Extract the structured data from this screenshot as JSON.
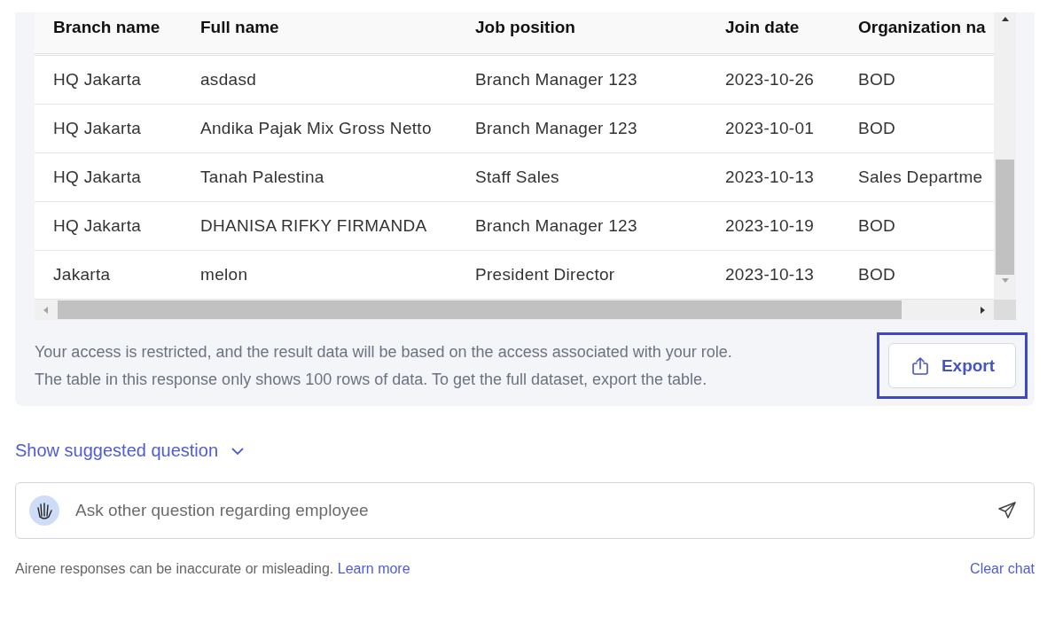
{
  "table": {
    "columns": [
      "Branch name",
      "Full name",
      "Job position",
      "Join date",
      "Organization na"
    ],
    "rows": [
      [
        "HQ Jakarta",
        "asdasd",
        "Branch Manager 123",
        "2023-10-26",
        "BOD"
      ],
      [
        "HQ Jakarta",
        "Andika Pajak Mix Gross Netto",
        "Branch Manager 123",
        "2023-10-01",
        "BOD"
      ],
      [
        "HQ Jakarta",
        "Tanah Palestina",
        "Staff Sales",
        "2023-10-13",
        "Sales Departme"
      ],
      [
        "HQ Jakarta",
        "DHANISA RIFKY FIRMANDA",
        "Branch Manager 123",
        "2023-10-19",
        "BOD"
      ],
      [
        "Jakarta",
        "melon",
        "President Director",
        "2023-10-13",
        "BOD"
      ]
    ]
  },
  "notice": [
    "Your access is restricted, and the result data will be based on the access associated with your role.",
    "The table in this response only shows 100 rows of data. To get the full dataset, export the table."
  ],
  "export_button": {
    "label": "Export",
    "highlighted": true
  },
  "suggested_toggle": "Show suggested question",
  "ask_field": {
    "placeholder": "Ask other question regarding employee"
  },
  "footer": {
    "disclaimer": "Airene responses can be inaccurate or misleading.",
    "link": "Learn more",
    "clear": "Clear chat"
  }
}
